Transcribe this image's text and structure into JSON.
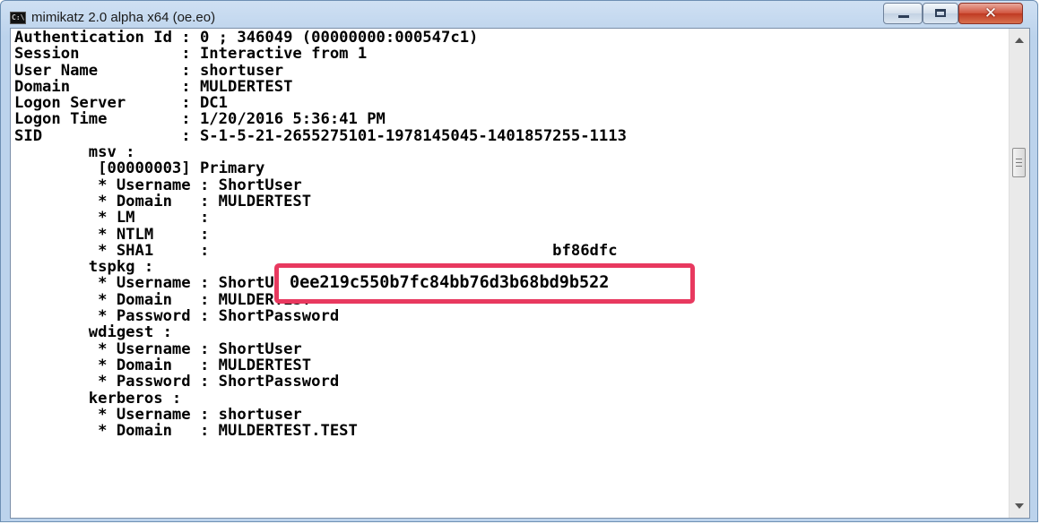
{
  "window": {
    "title": "mimikatz 2.0 alpha x64 (oe.eo)",
    "icon": "console-icon",
    "icon_text": "C:\\",
    "controls": {
      "minimize": "minimize-icon",
      "maximize": "maximize-icon",
      "close": "✕"
    }
  },
  "console": {
    "lines": [
      "Authentication Id : 0 ; 346049 (00000000:000547c1)",
      "Session           : Interactive from 1",
      "User Name         : shortuser",
      "Domain            : MULDERTEST",
      "Logon Server      : DC1",
      "Logon Time        : 1/20/2016 5:36:41 PM",
      "SID               : S-1-5-21-2655275101-1978145045-1401857255-1113",
      "        msv :",
      "         [00000003] Primary",
      "         * Username : ShortUser",
      "         * Domain   : MULDERTEST",
      "         * LM       :",
      "         * NTLM     :",
      "         * SHA1     :                                     bf86dfc",
      "        tspkg :",
      "         * Username : ShortUser",
      "         * Domain   : MULDERTEST",
      "         * Password : ShortPassword",
      "        wdigest :",
      "         * Username : ShortUser",
      "         * Domain   : MULDERTEST",
      "         * Password : ShortPassword",
      "        kerberos :",
      "         * Username : shortuser",
      "         * Domain   : MULDERTEST.TEST"
    ],
    "highlight_value": "0ee219c550b7fc84bb76d3b68bd9b522",
    "highlight_color": "#e8395f"
  },
  "scrollbar": {
    "up": "scroll-up-arrow-icon",
    "down": "scroll-down-arrow-icon"
  }
}
